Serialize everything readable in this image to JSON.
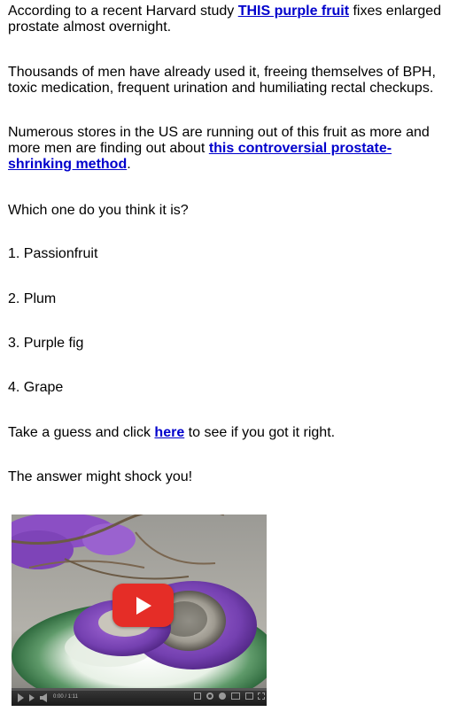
{
  "article": {
    "p1": {
      "before": "According to a recent Harvard study ",
      "link": "THIS purple fruit",
      "after": " fixes enlarged prostate almost overnight."
    },
    "p2": "Thousands of men have already used it, freeing themselves of BPH, toxic medication, frequent urination and humiliating rectal checkups.",
    "p3": {
      "before": "Numerous stores in the US are running out of this fruit as more and more men are finding out about ",
      "link": "this controversial prostate-shrinking method",
      "after": "."
    },
    "question": "Which one do you think it is?",
    "options": [
      "1. Passionfruit",
      "2. Plum",
      "3. Purple fig",
      "4. Grape"
    ],
    "cta": {
      "before": "Take a guess and click ",
      "link": "here",
      "after": " to see if you got it right."
    },
    "closing": "The answer might shock you!"
  },
  "video": {
    "time": "0:00 / 1:11",
    "progress_fraction": 0.0,
    "play_button_color": "#e52d27",
    "icons": [
      "play-icon",
      "next-icon",
      "volume-icon",
      "captions-icon",
      "settings-icon",
      "youtube-icon",
      "miniplayer-icon",
      "theater-icon",
      "fullscreen-icon"
    ]
  },
  "colors": {
    "link": "#0000cc",
    "text": "#000000"
  }
}
